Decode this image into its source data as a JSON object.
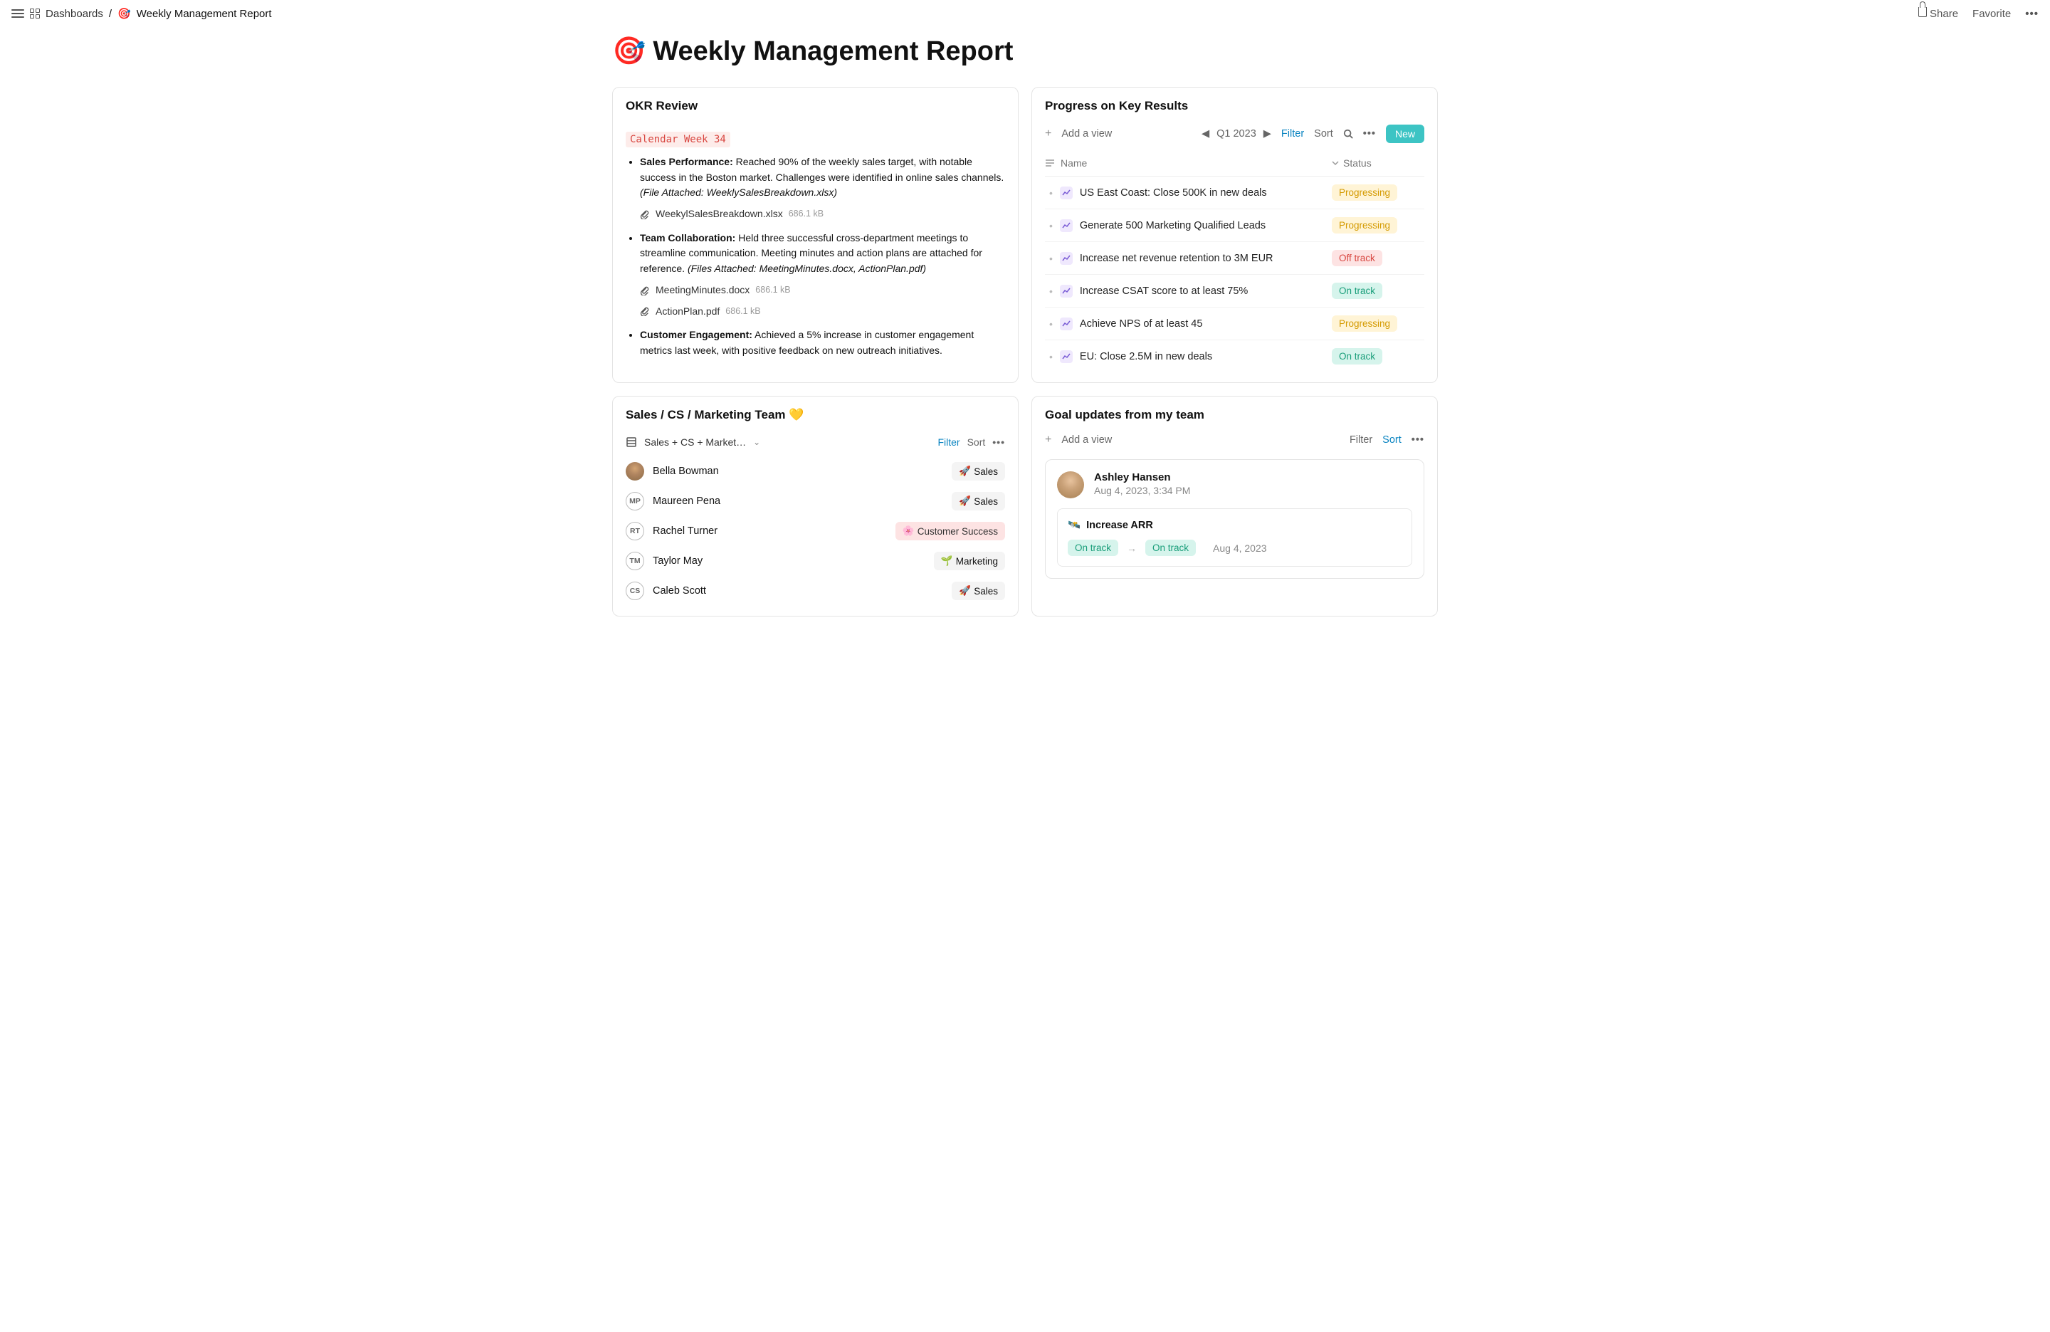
{
  "breadcrumb": {
    "root": "Dashboards",
    "page": "Weekly Management Report",
    "emoji": "🎯"
  },
  "topbar": {
    "share": "Share",
    "favorite": "Favorite"
  },
  "page_title": {
    "emoji": "🎯",
    "text": "Weekly Management Report"
  },
  "okr": {
    "title": "OKR Review",
    "week_label": "Calendar Week 34",
    "bullets": [
      {
        "label": "Sales Performance:",
        "text": " Reached 90% of the weekly sales target, with notable success in the Boston market. Challenges were identified in online sales channels. ",
        "note": "(File Attached: WeeklySalesBreakdown.xlsx)",
        "attachments": [
          {
            "name": "WeekylSalesBreakdown.xlsx",
            "size": "686.1 kB"
          }
        ]
      },
      {
        "label": "Team Collaboration:",
        "text": " Held three successful cross-department meetings to streamline communication. Meeting minutes and action plans are attached for reference. ",
        "note": "(Files Attached: MeetingMinutes.docx, ActionPlan.pdf)",
        "attachments": [
          {
            "name": "MeetingMinutes.docx",
            "size": "686.1 kB"
          },
          {
            "name": "ActionPlan.pdf",
            "size": "686.1 kB"
          }
        ]
      },
      {
        "label": "Customer Engagement:",
        "text": " Achieved a 5% increase in customer engagement metrics last week, with positive feedback on new outreach initiatives.",
        "note": "",
        "attachments": []
      }
    ]
  },
  "key_results": {
    "title": "Progress on Key Results",
    "add_view": "Add a view",
    "period": "Q1 2023",
    "filter": "Filter",
    "sort": "Sort",
    "new": "New",
    "col_name": "Name",
    "col_status": "Status",
    "rows": [
      {
        "title": "US East Coast: Close 500K in new deals",
        "status": "Progressing",
        "status_class": "st-progressing"
      },
      {
        "title": "Generate 500 Marketing Qualified Leads",
        "status": "Progressing",
        "status_class": "st-progressing"
      },
      {
        "title": "Increase net revenue retention to 3M EUR",
        "status": "Off track",
        "status_class": "st-offtrack"
      },
      {
        "title": "Increase CSAT score to at least 75%",
        "status": "On track",
        "status_class": "st-ontrack"
      },
      {
        "title": "Achieve NPS of at least 45",
        "status": "Progressing",
        "status_class": "st-progressing"
      },
      {
        "title": "EU: Close 2.5M in new deals",
        "status": "On track",
        "status_class": "st-ontrack"
      }
    ]
  },
  "team": {
    "title": "Sales / CS / Marketing Team 💛",
    "view": "Sales + CS + Market…",
    "filter": "Filter",
    "sort": "Sort",
    "members": [
      {
        "name": "Bella Bowman",
        "avatar_type": "photo1",
        "initials": "",
        "tag_emoji": "🚀",
        "tag": "Sales",
        "tag_class": ""
      },
      {
        "name": "Maureen Pena",
        "avatar_type": "",
        "initials": "MP",
        "tag_emoji": "🚀",
        "tag": "Sales",
        "tag_class": ""
      },
      {
        "name": "Rachel Turner",
        "avatar_type": "",
        "initials": "RT",
        "tag_emoji": "🌸",
        "tag": "Customer Success",
        "tag_class": "cs"
      },
      {
        "name": "Taylor May",
        "avatar_type": "",
        "initials": "TM",
        "tag_emoji": "🌱",
        "tag": "Marketing",
        "tag_class": ""
      },
      {
        "name": "Caleb Scott",
        "avatar_type": "",
        "initials": "CS",
        "tag_emoji": "🚀",
        "tag": "Sales",
        "tag_class": ""
      }
    ]
  },
  "updates": {
    "title": "Goal updates from my team",
    "add_view": "Add a view",
    "filter": "Filter",
    "sort": "Sort",
    "entry": {
      "author": "Ashley Hansen",
      "timestamp": "Aug 4, 2023, 3:34 PM",
      "goal_emoji": "🛰️",
      "goal_title": "Increase ARR",
      "from_status": "On track",
      "to_status": "On track",
      "date": "Aug 4, 2023"
    }
  }
}
